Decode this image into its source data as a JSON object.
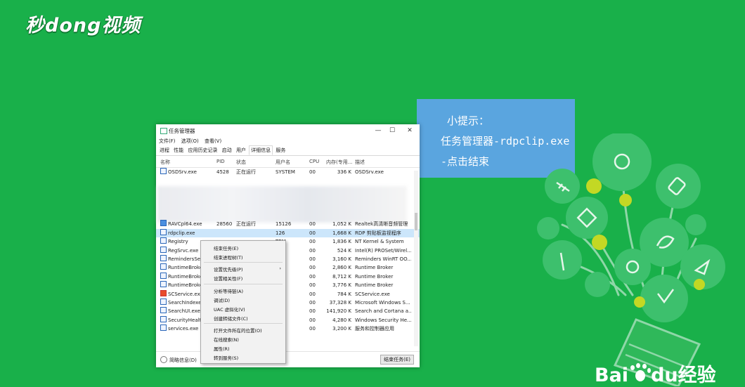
{
  "logo": {
    "text": "秒dong视频"
  },
  "tip": {
    "line1": "小提示：",
    "line2": "任务管理器-rdpclip.exe",
    "line3": "-点击结束"
  },
  "window": {
    "title": "任务管理器",
    "controls": {
      "minimize": "—",
      "maximize": "☐",
      "close": "✕"
    },
    "menu": [
      "文件(F)",
      "选项(O)",
      "查看(V)"
    ],
    "tabs": [
      "进程",
      "性能",
      "应用历史记录",
      "启动",
      "用户",
      "详细信息",
      "服务"
    ],
    "active_tab": "详细信息",
    "columns": [
      "名称",
      "PID",
      "状态",
      "用户名",
      "CPU",
      "内存(专用...",
      "描述"
    ],
    "rows": [
      {
        "name": "OSDSrv.exe",
        "pid": "4528",
        "status": "正在运行",
        "user": "SYSTEM",
        "cpu": "00",
        "mem": "336 K",
        "desc": "OSDSrv.exe",
        "icon": "window"
      },
      {
        "name": "RAVCpl64.exe",
        "pid": "28560",
        "status": "正在运行",
        "user": "15126",
        "cpu": "00",
        "mem": "1,052 K",
        "desc": "Realtek高清晰音频管理",
        "icon": "speaker"
      },
      {
        "name": "rdpclip.exe",
        "pid": "",
        "status": "",
        "user": "126",
        "cpu": "00",
        "mem": "1,668 K",
        "desc": "RDP 剪贴板监视程序",
        "icon": "window",
        "selected": true
      },
      {
        "name": "Registry",
        "pid": "",
        "status": "",
        "user": "TEM",
        "cpu": "00",
        "mem": "1,836 K",
        "desc": "NT Kernel & System",
        "icon": "window"
      },
      {
        "name": "RegSrvc.exe",
        "pid": "",
        "status": "",
        "user": "TEM",
        "cpu": "00",
        "mem": "524 K",
        "desc": "Intel(R) PROSet/Wirel...",
        "icon": "window"
      },
      {
        "name": "RemindersServ",
        "pid": "",
        "status": "",
        "user": "126",
        "cpu": "00",
        "mem": "3,160 K",
        "desc": "Reminders WinRT OO...",
        "icon": "window"
      },
      {
        "name": "RuntimeBroker",
        "pid": "",
        "status": "",
        "user": "126",
        "cpu": "00",
        "mem": "2,860 K",
        "desc": "Runtime Broker",
        "icon": "window"
      },
      {
        "name": "RuntimeBroker",
        "pid": "",
        "status": "",
        "user": "126",
        "cpu": "00",
        "mem": "8,712 K",
        "desc": "Runtime Broker",
        "icon": "window"
      },
      {
        "name": "RuntimeBroker",
        "pid": "",
        "status": "",
        "user": "126",
        "cpu": "00",
        "mem": "3,776 K",
        "desc": "Runtime Broker",
        "icon": "window"
      },
      {
        "name": "SCService.exe",
        "pid": "",
        "status": "",
        "user": "TEM",
        "cpu": "00",
        "mem": "784 K",
        "desc": "SCService.exe",
        "icon": "red"
      },
      {
        "name": "SearchIndexer.",
        "pid": "",
        "status": "",
        "user": "TEM",
        "cpu": "00",
        "mem": "37,328 K",
        "desc": "Microsoft Windows S...",
        "icon": "window"
      },
      {
        "name": "SearchUI.exe",
        "pid": "",
        "status": "",
        "user": "126",
        "cpu": "00",
        "mem": "141,920 K",
        "desc": "Search and Cortana a...",
        "icon": "window"
      },
      {
        "name": "SecurityHealthS",
        "pid": "",
        "status": "",
        "user": "TEM",
        "cpu": "00",
        "mem": "4,280 K",
        "desc": "Windows Security He...",
        "icon": "window"
      },
      {
        "name": "services.exe",
        "pid": "",
        "status": "",
        "user": "TEM",
        "cpu": "00",
        "mem": "3,200 K",
        "desc": "服务和控制器应用",
        "icon": "window"
      }
    ],
    "footer": {
      "less_details": "简略信息(D)",
      "end_task": "结束任务(E)"
    }
  },
  "context_menu": [
    "结束任务(E)",
    "结束进程树(T)",
    "设置优先级(P)",
    "设置相关性(F)",
    "分析等待链(A)",
    "调试(D)",
    "UAC 虚拟化(V)",
    "创建转储文件(C)",
    "打开文件所在的位置(O)",
    "在线搜索(N)",
    "属性(R)",
    "转到服务(S)"
  ],
  "baidu": {
    "bai": "Bai",
    "du": "du",
    "jingyan": "经验"
  },
  "colors": {
    "background": "#19b04a",
    "tip_box": "#5aa5df",
    "selected_row": "#cce6fb"
  }
}
